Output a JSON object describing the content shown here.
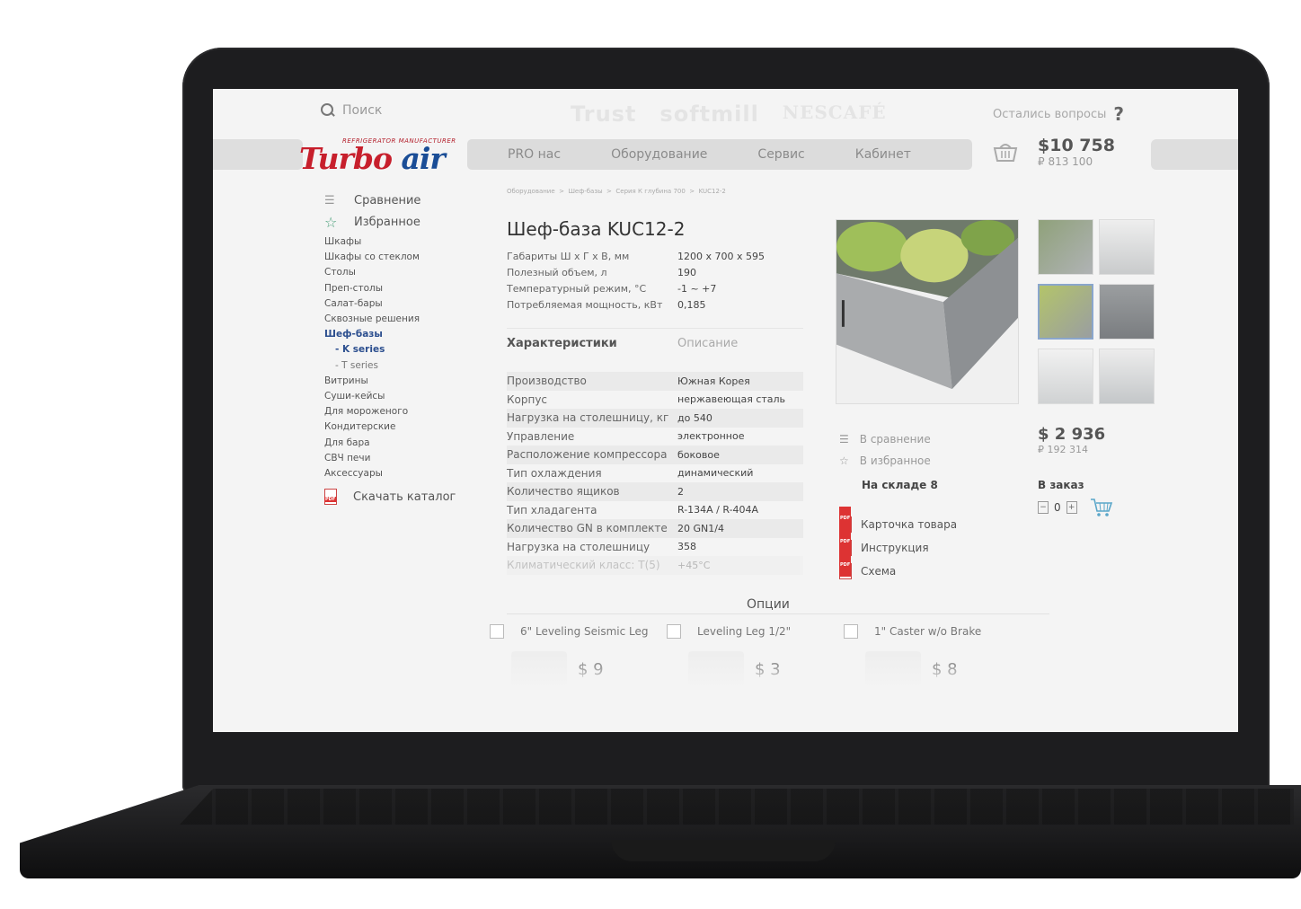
{
  "search": {
    "placeholder": "Поиск"
  },
  "partners": [
    "Trust",
    "softmill",
    "NESCAFÉ"
  ],
  "questions": {
    "label": "Остались вопросы",
    "icon": "?"
  },
  "logo": {
    "main": "Turbo",
    "accent": "air",
    "sub": "REFRIGERATOR MANUFACTURER"
  },
  "nav": [
    "PRO нас",
    "Оборудование",
    "Сервис",
    "Кабинет"
  ],
  "cart_total": {
    "usd": "$10 758",
    "rub": "₽ 813 100"
  },
  "sidebar": {
    "compare": "Сравнение",
    "favorites": "Избранное",
    "categories": [
      "Шкафы",
      "Шкафы со стеклом",
      "Столы",
      "Преп-столы",
      "Салат-бары",
      "Сквозные решения",
      "Шеф-базы",
      "K series",
      "T series",
      "Витрины",
      "Суши-кейсы",
      "Для мороженого",
      "Кондитерские",
      "Для бара",
      "СВЧ печи",
      "Аксессуары"
    ],
    "download": "Скачать каталог"
  },
  "breadcrumb": [
    "Оборудование",
    "Шеф-базы",
    "Серия К глубина 700",
    "KUC12-2"
  ],
  "product": {
    "title": "Шеф-база KUC12-2",
    "specs": [
      {
        "k": "Габариты  Ш x Г x В, мм",
        "v": "1200 x 700 x 595"
      },
      {
        "k": "Полезный объем, л",
        "v": "190"
      },
      {
        "k": "Температурный режим,  °С",
        "v": "-1  ~  +7"
      },
      {
        "k": "Потребляемая мощность, кВт",
        "v": "0,185"
      }
    ],
    "tabs": [
      "Характеристики",
      "Описание"
    ],
    "characteristics": [
      {
        "k": "Производство",
        "v": "Южная Корея"
      },
      {
        "k": "Корпус",
        "v": "нержавеющая сталь"
      },
      {
        "k": "Нагрузка на столешницу, кг",
        "v": "до 540"
      },
      {
        "k": "Управление",
        "v": "электронное"
      },
      {
        "k": "Расположение компрессора",
        "v": "боковое"
      },
      {
        "k": "Тип охлаждения",
        "v": "динамический"
      },
      {
        "k": "Количество ящиков",
        "v": "2"
      },
      {
        "k": "Тип хладагента",
        "v": "R-134A / R-404A"
      },
      {
        "k": "Количество GN в комплекте",
        "v": "20 GN1/4"
      },
      {
        "k": "Нагрузка на столешницу",
        "v": "358"
      },
      {
        "k": "Климатический класс: T(5)",
        "v": "+45°С"
      }
    ],
    "actions": {
      "compare": "В сравнение",
      "favorite": "В избранное"
    },
    "stock": "На складе   8",
    "docs": [
      "Карточка товара",
      "Инструкция",
      "Схема"
    ],
    "price": {
      "usd": "$ 2 936",
      "rub": "₽ 192 314"
    },
    "order_label": "В заказ",
    "quantity": "0"
  },
  "options": {
    "title": "Опции",
    "items": [
      {
        "name": "6\" Leveling Seismic Leg",
        "price": "$ 9"
      },
      {
        "name": "Leveling Leg 1/2\"",
        "price": "$ 3"
      },
      {
        "name": "1\" Caster w/o Brake",
        "price": "$ 8"
      }
    ]
  }
}
